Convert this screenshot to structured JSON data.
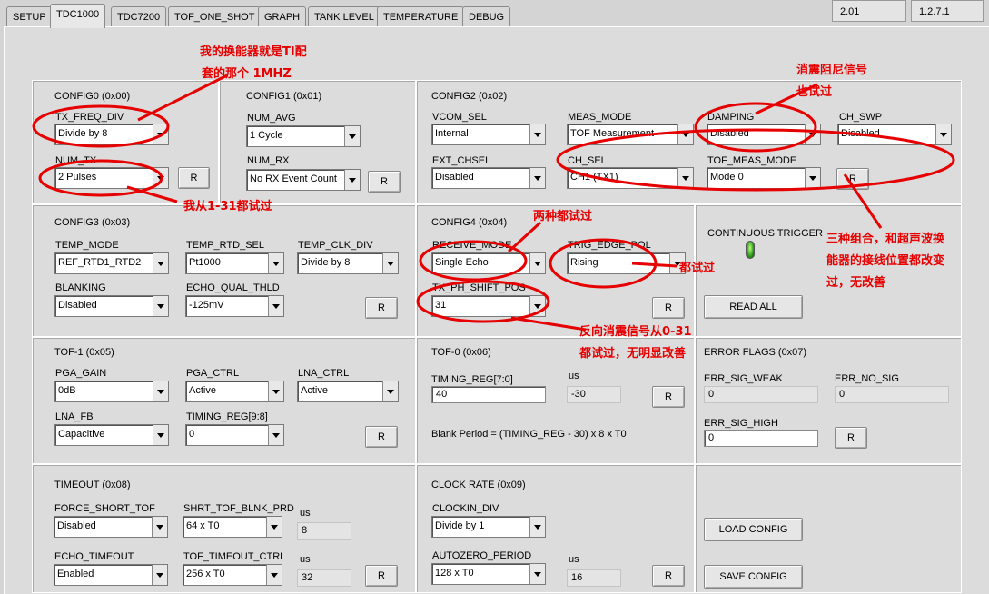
{
  "tabs": [
    "SETUP",
    "TDC1000",
    "TDC7200",
    "TOF_ONE_SHOT",
    "GRAPH",
    "TANK LEVEL",
    "TEMPERATURE",
    "DEBUG"
  ],
  "versions": [
    "2.01",
    "1.2.7.1"
  ],
  "config0": {
    "title": "CONFIG0 (0x00)",
    "tx_freq_div_label": "TX_FREQ_DIV",
    "tx_freq_div": "Divide by 8",
    "num_tx_label": "NUM_TX",
    "num_tx": "2 Pulses",
    "r": "R"
  },
  "config1": {
    "title": "CONFIG1 (0x01)",
    "num_avg_label": "NUM_AVG",
    "num_avg": "1 Cycle",
    "num_rx_label": "NUM_RX",
    "num_rx": "No RX Event Count",
    "r": "R"
  },
  "config2": {
    "title": "CONFIG2 (0x02)",
    "vcom_sel_label": "VCOM_SEL",
    "vcom_sel": "Internal",
    "meas_mode_label": "MEAS_MODE",
    "meas_mode": "TOF Measurement",
    "damping_label": "DAMPING",
    "damping": "Disabled",
    "ch_swp_label": "CH_SWP",
    "ch_swp": "Disabled",
    "ext_chsel_label": "EXT_CHSEL",
    "ext_chsel": "Disabled",
    "ch_sel_label": "CH_SEL",
    "ch_sel": "CH1 (TX1)",
    "tof_meas_mode_label": "TOF_MEAS_MODE",
    "tof_meas_mode": "Mode 0",
    "r": "R"
  },
  "config3": {
    "title": "CONFIG3 (0x03)",
    "temp_mode_label": "TEMP_MODE",
    "temp_mode": "REF_RTD1_RTD2",
    "temp_rtd_sel_label": "TEMP_RTD_SEL",
    "temp_rtd_sel": "Pt1000",
    "temp_clk_div_label": "TEMP_CLK_DIV",
    "temp_clk_div": "Divide by 8",
    "blanking_label": "BLANKING",
    "blanking": "Disabled",
    "echo_qual_thld_label": "ECHO_QUAL_THLD",
    "echo_qual_thld": "-125mV",
    "r": "R"
  },
  "config4": {
    "title": "CONFIG4 (0x04)",
    "receive_mode_label": "RECEIVE_MODE",
    "receive_mode": "Single Echo",
    "trig_edge_pol_label": "TRIG_EDGE_POL",
    "trig_edge_pol": "Rising",
    "tx_ph_shift_pos_label": "TX_PH_SHIFT_POS",
    "tx_ph_shift_pos": "31",
    "r": "R"
  },
  "trigger": {
    "label": "CONTINUOUS TRIGGER",
    "read_all": "READ ALL"
  },
  "tof1": {
    "title": "TOF-1 (0x05)",
    "pga_gain_label": "PGA_GAIN",
    "pga_gain": "0dB",
    "pga_ctrl_label": "PGA_CTRL",
    "pga_ctrl": "Active",
    "lna_ctrl_label": "LNA_CTRL",
    "lna_ctrl": "Active",
    "lna_fb_label": "LNA_FB",
    "lna_fb": "Capacitive",
    "timing_reg98_label": "TIMING_REG[9:8]",
    "timing_reg98": "0",
    "r": "R"
  },
  "tof0": {
    "title": "TOF-0 (0x06)",
    "timing_reg70_label": "TIMING_REG[7:0]",
    "timing_reg70": "40",
    "us_label": "us",
    "us_value": "-30",
    "formula": "Blank Period = (TIMING_REG - 30) x 8 x T0",
    "r": "R"
  },
  "errflags": {
    "title": "ERROR FLAGS (0x07)",
    "sig_weak_label": "ERR_SIG_WEAK",
    "sig_weak": "0",
    "no_sig_label": "ERR_NO_SIG",
    "no_sig": "0",
    "sig_high_label": "ERR_SIG_HIGH",
    "sig_high": "0",
    "r": "R"
  },
  "timeout": {
    "title": "TIMEOUT (0x08)",
    "force_short_tof_label": "FORCE_SHORT_TOF",
    "force_short_tof": "Disabled",
    "shrt_tof_blnk_prd_label": "SHRT_TOF_BLNK_PRD",
    "shrt_tof_blnk_prd": "64 x T0",
    "us1_label": "us",
    "us1": "8",
    "echo_timeout_label": "ECHO_TIMEOUT",
    "echo_timeout": "Enabled",
    "tof_timeout_ctrl_label": "TOF_TIMEOUT_CTRL",
    "tof_timeout_ctrl": "256 x T0",
    "us2_label": "us",
    "us2": "32",
    "r": "R"
  },
  "clockrate": {
    "title": "CLOCK RATE (0x09)",
    "clockin_div_label": "CLOCKIN_DIV",
    "clockin_div": "Divide by 1",
    "autozero_period_label": "AUTOZERO_PERIOD",
    "autozero_period": "128 x T0",
    "us_label": "us",
    "us": "16",
    "r": "R"
  },
  "config_buttons": {
    "load": "LOAD CONFIG",
    "save": "SAVE CONFIG"
  },
  "annotations": {
    "a1_line1": "我的换能器就是TI配",
    "a1_line2": "套的那个 1MHZ",
    "a2": "我从1-31都试过",
    "a3_line1": "消震阻尼信号",
    "a3_line2": "也试过",
    "a4": "两种都试过",
    "a5": "都试过",
    "a6_line1": "三种组合，和超声波换",
    "a6_line2": "能器的接线位置都改变",
    "a6_line3": "过，无改善",
    "a7_line1": "反向消震信号从0-31",
    "a7_line2": "都试过，无明显改善"
  },
  "colors": {
    "annotation": "#e60000"
  }
}
